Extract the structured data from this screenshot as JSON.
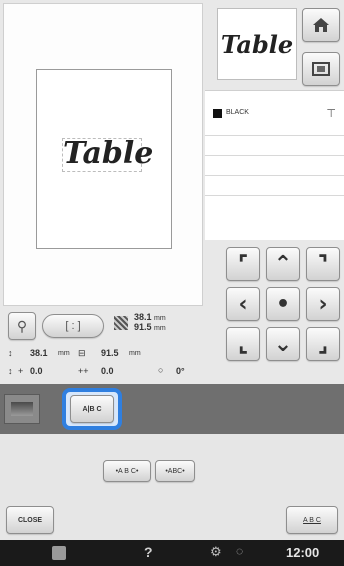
{
  "preview": {
    "text": "Table"
  },
  "thumbnail": {
    "text": "Table"
  },
  "color_list": {
    "first_color": "BLACK"
  },
  "info": {
    "size_w": "38.1",
    "size_h": "91.5",
    "size_w2": "38.1",
    "size_h2": "91.5",
    "unit": "mm",
    "offset_x": "0.0",
    "offset_y": "0.0",
    "angle": "0°",
    "sign": "+",
    "sign2": "++"
  },
  "tabs": {
    "abc": "A|B C"
  },
  "spacing": {
    "decrease": "•A B C•",
    "increase": "•ABC•"
  },
  "buttons": {
    "close": "CLOSE",
    "abc_right": "A B C"
  },
  "status": {
    "help": "?",
    "time": "12:00"
  },
  "colors": {
    "accent": "#2f7fe0",
    "status_bar": "#1a1a1a"
  }
}
